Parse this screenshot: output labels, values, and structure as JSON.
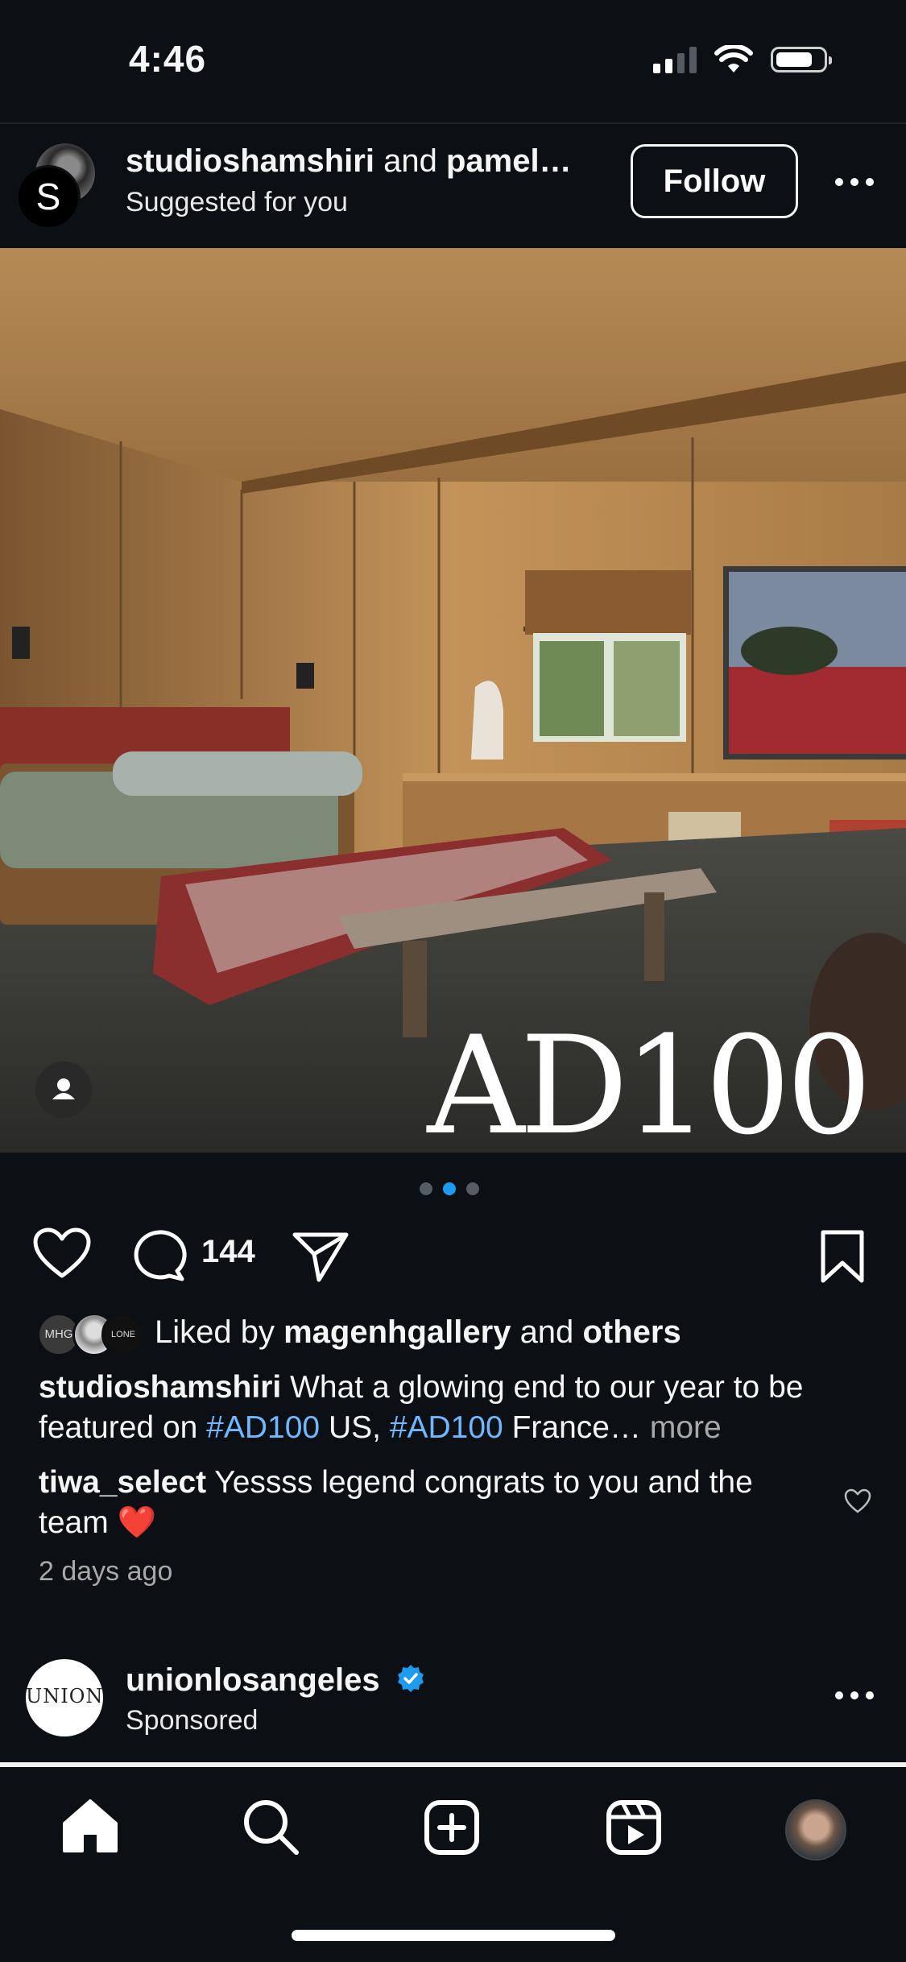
{
  "status_bar": {
    "time": "4:46"
  },
  "post": {
    "header": {
      "account": "studioshamshiri",
      "connector": "and",
      "collaborator": "pamel…",
      "subtitle": "Suggested for you",
      "avatar_letter": "S",
      "follow_label": "Follow"
    },
    "image": {
      "watermark": "AD100"
    },
    "carousel": {
      "count": 3,
      "active_index": 1
    },
    "actions": {
      "comment_count": "144"
    },
    "likes": {
      "avatar_1_text": "MHG",
      "avatar_3_text": "LONE",
      "prefix": "Liked by",
      "user": "magenhgallery",
      "connector": "and",
      "others": "others"
    },
    "caption": {
      "user": "studioshamshiri",
      "text_1": "What a glowing end to our year to be featured on",
      "hashtag_1": "#AD100",
      "text_2": "US,",
      "hashtag_2": "#AD100",
      "text_3": "France…",
      "more": "more"
    },
    "comment": {
      "user": "tiwa_select",
      "text": "Yessss legend congrats to you and the team",
      "emoji": "❤️"
    },
    "timestamp": "2 days ago"
  },
  "sponsored_post": {
    "account": "unionlosangeles",
    "subtitle": "Sponsored",
    "avatar_text": "UNION",
    "verified_color": "#1d9bf0"
  },
  "colors": {
    "background": "#0c1014",
    "accent": "#1d9bf0",
    "hashtag": "#6fb8ff",
    "like_heart": "#e0245e"
  },
  "tab_bar": {
    "items": [
      "home-icon",
      "search-icon",
      "create-icon",
      "reels-icon",
      "profile-avatar"
    ],
    "active": "home-icon"
  }
}
